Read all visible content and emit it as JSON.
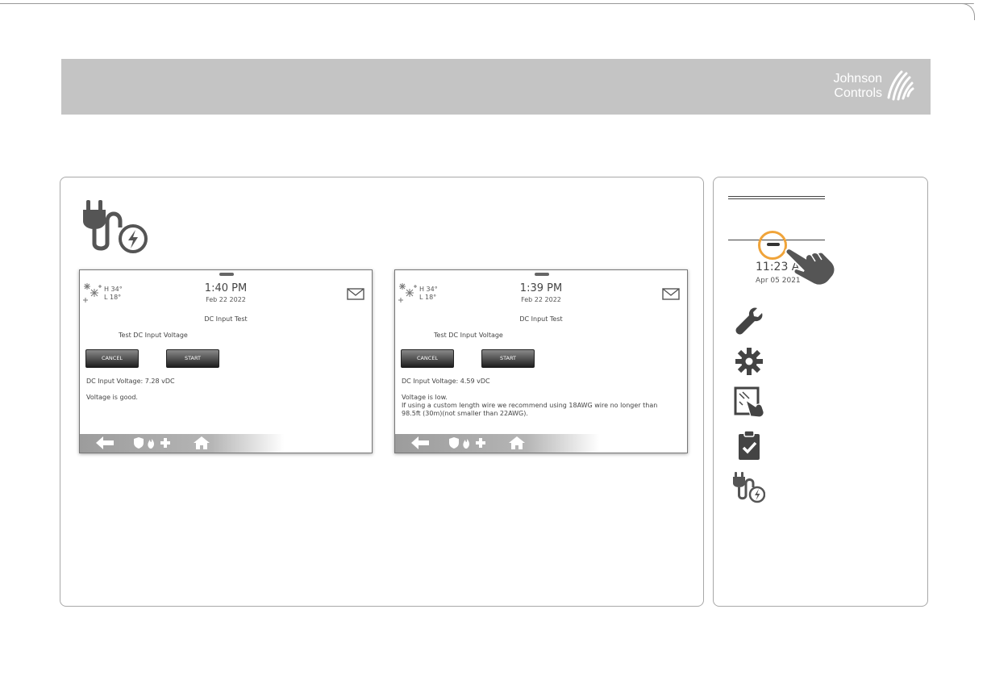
{
  "brand": {
    "logo_line1": "Johnson",
    "logo_line2": "Controls",
    "banner_color": "#c4c4c4",
    "accent_orange": "#f0a43a"
  },
  "screens": [
    {
      "temp_high": "H 34°",
      "temp_low": "L 18°",
      "time": "1:40 PM",
      "date": "Feb 22 2022",
      "title": "DC Input Test",
      "subtitle": "Test DC Input Voltage",
      "cancel_label": "CANCEL",
      "start_label": "START",
      "voltage_line": "DC Input Voltage: 7.28 vDC",
      "status_line": "Voltage is good.",
      "advice_line1": "",
      "advice_line2": ""
    },
    {
      "temp_high": "H 34°",
      "temp_low": "L 18°",
      "time": "1:39 PM",
      "date": "Feb 22 2022",
      "title": "DC Input Test",
      "subtitle": "Test DC Input Voltage",
      "cancel_label": "CANCEL",
      "start_label": "START",
      "voltage_line": "DC Input Voltage: 4.59 vDC",
      "status_line": "Voltage is low.",
      "advice_line1": "If using a custom length wire we recommend using 18AWG wire no longer than",
      "advice_line2": "98.5ft (30m)(not smaller than 22AWG)."
    }
  ],
  "nav": {
    "time": "11:23 AM",
    "date": "Apr 05 2021",
    "icons": [
      "wrench-icon",
      "gear-icon",
      "touchscreen-hand-icon",
      "clipboard-check-icon",
      "power-plug-icon"
    ]
  }
}
